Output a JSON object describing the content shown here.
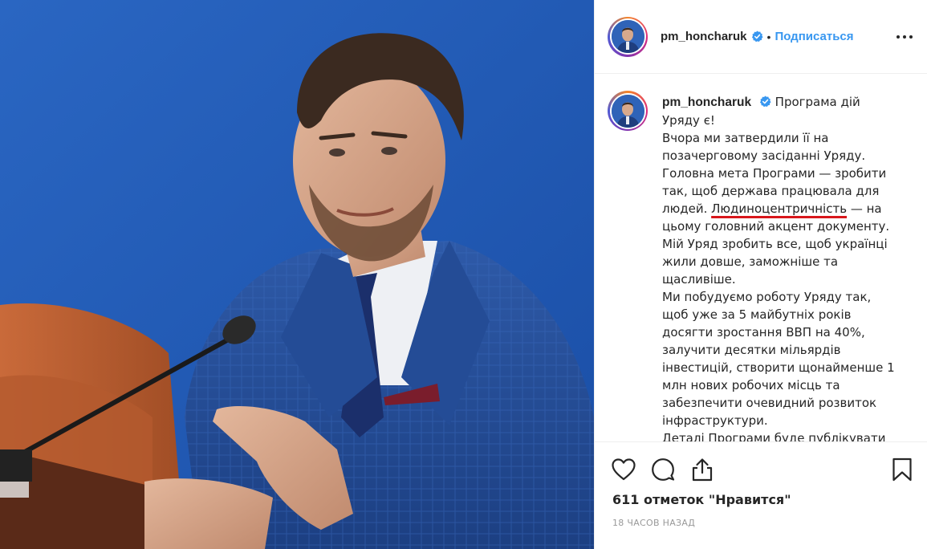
{
  "post": {
    "username": "pm_honcharuk",
    "separator": "•",
    "follow_label": "Подписаться",
    "caption_username": "pm_honcharuk",
    "caption_lines": [
      "Програма дій",
      "Уряду є!",
      "Вчора ми затвердили її на",
      "позачерговому засіданні Уряду.",
      "Головна мета Програми — зробити",
      "так, щоб держава працювала для",
      "людей.",
      "Людиноцентричність",
      "— на",
      "цьому головний акцент документу.",
      "Мій Уряд зробить все, щоб українці",
      "жили довше, заможніше та",
      "щасливіше.",
      "Ми побудуємо роботу Уряду так,",
      "щоб уже за 5 майбутніх років",
      "досягти зростання ВВП на 40%,",
      "залучити десятки мільярдів",
      "інвестицій, створити щонайменше 1",
      "млн нових робочих місць та",
      "забезпечити очевидний розвиток",
      "інфраструктури.",
      "Деталі Програми буде публікувати"
    ],
    "likes_text": "611 отметок \"Нравится\"",
    "time_text": "18 ЧАСОВ НАЗАД"
  },
  "icons": {
    "verified": "verified-badge-icon",
    "more": "more-options-icon",
    "like": "heart-icon",
    "comment": "comment-icon",
    "share": "share-icon",
    "save": "bookmark-icon"
  },
  "colors": {
    "link": "#3897f0",
    "text": "#262626",
    "muted": "#999999",
    "underline": "#d8161b",
    "photo_background": "#1f5bb3"
  }
}
